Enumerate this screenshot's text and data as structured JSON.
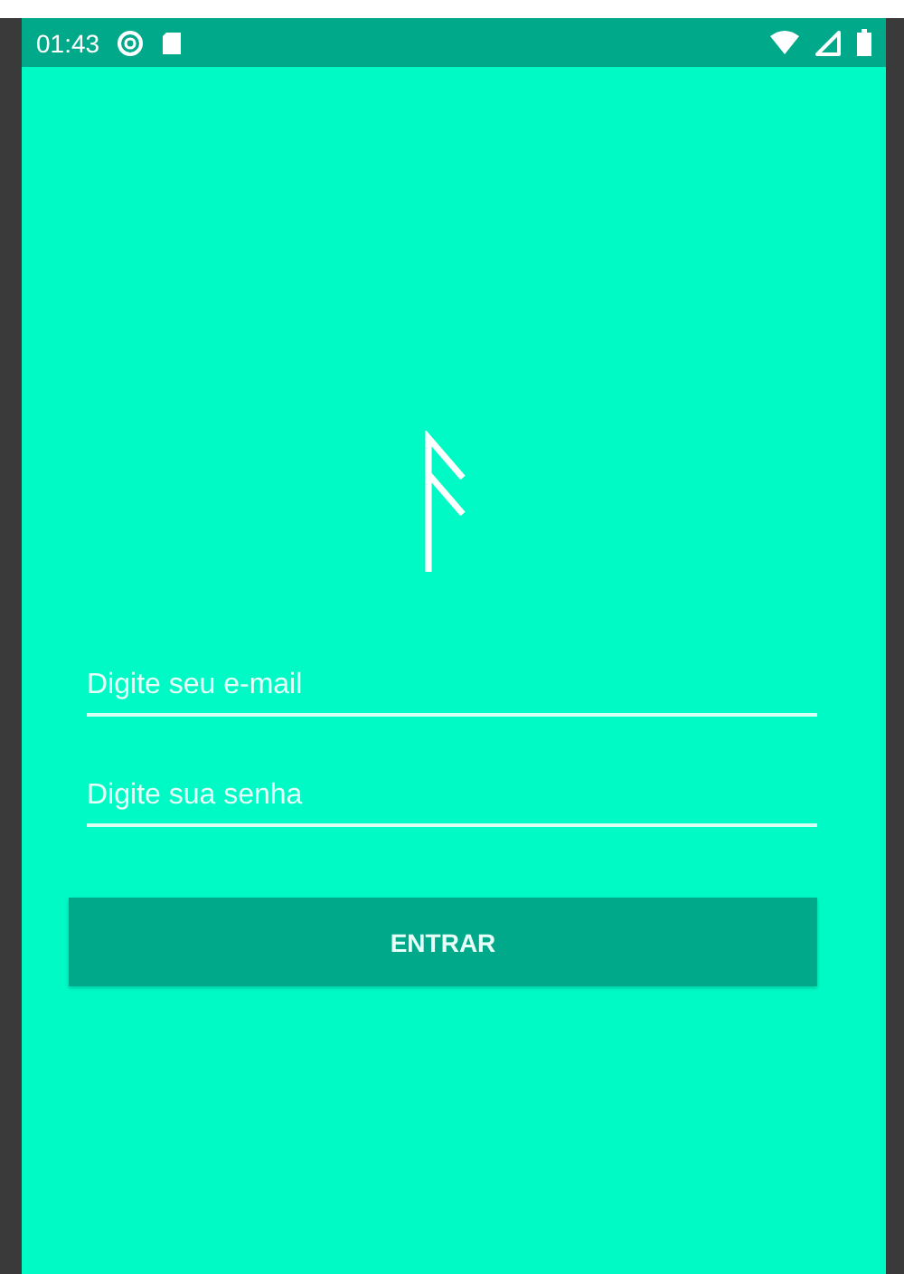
{
  "status_bar": {
    "time": "01:43"
  },
  "fields": [
    {
      "placeholder": "Digite seu e-mail"
    },
    {
      "placeholder": "Digite sua senha"
    }
  ],
  "buttons": [
    {
      "label": "ENTRAR"
    }
  ]
}
